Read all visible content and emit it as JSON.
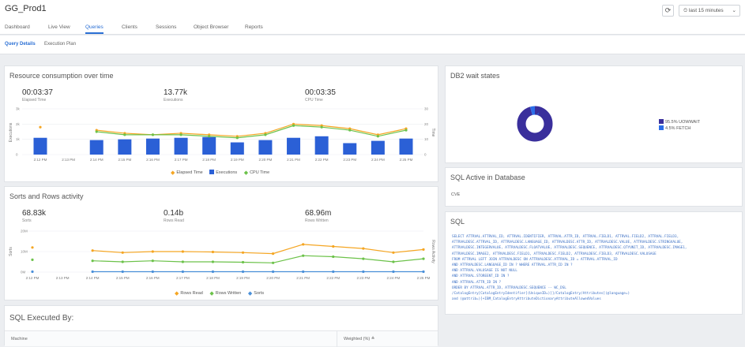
{
  "app": {
    "title": "GG_Prod1"
  },
  "nav": {
    "tabs": [
      "Dashboard",
      "Live View",
      "Queries",
      "Clients",
      "Sessions",
      "Object Browser",
      "Reports"
    ],
    "active": "Queries"
  },
  "toolbar": {
    "refresh_icon": "refresh-icon",
    "time_range": "last 15 minutes",
    "time_icon": "clock-icon"
  },
  "subtabs": {
    "items": [
      "Query Details",
      "Execution Plan"
    ],
    "active": "Query Details"
  },
  "resource": {
    "title": "Resource consumption over time",
    "metrics": [
      {
        "value": "00:03:37",
        "label": "Elapsed Time"
      },
      {
        "value": "13.77k",
        "label": "Executions"
      },
      {
        "value": "00:03:35",
        "label": "CPU Time"
      }
    ],
    "y_left_label": "Executions",
    "y_right_label": "Time",
    "y_left_ticks": [
      "3k",
      "2k",
      "1k",
      "0"
    ],
    "y_right_ticks": [
      "30",
      "20",
      "10",
      "0"
    ],
    "legend": [
      "Elapsed Time",
      "Executions",
      "CPU Time"
    ]
  },
  "sorts": {
    "title": "Sorts and Rows activity",
    "metrics": [
      {
        "value": "68.83k",
        "label": "Sorts"
      },
      {
        "value": "0.14b",
        "label": "Rows Read"
      },
      {
        "value": "68.96m",
        "label": "Rows Written"
      }
    ],
    "y_left_label": "Sorts",
    "y_right_label": "Rows Activity",
    "y_left_ticks": [
      "20M",
      "10M",
      "0M"
    ],
    "legend": [
      "Rows Read",
      "Rows Written",
      "Sorts"
    ]
  },
  "executed_by": {
    "title": "SQL Executed By:",
    "columns": [
      "Machine",
      "Weighted (%) ≜"
    ]
  },
  "db2wait": {
    "title": "DB2 wait states",
    "legend": [
      "95.5% UOWWAIT",
      "4.5% FETCH"
    ],
    "colors": [
      "#3a2f9c",
      "#2b6ee8"
    ]
  },
  "active": {
    "title": "SQL Active in Database",
    "value": "CVE"
  },
  "sql": {
    "title": "SQL",
    "lines": [
      "SELECT ATTRVAL.ATTRVAL_ID, ATTRVAL.IDENTIFIER, ATTRVAL.ATTR_ID, ATTRVAL.FIELD1, ATTRVAL.FIELD2, ATTRVAL.FIELD3,",
      "ATTRVALDESC.ATTRVAL_ID, ATTRVALDESC.LANGUAGE_ID, ATTRVALDESC.ATTR_ID, ATTRVALDESC.VALUE, ATTRVALDESC.STRINGVALUE,",
      "ATTRVALDESC.INTEGERVALUE, ATTRVALDESC.FLOATVALUE, ATTRVALDESC.SEQUENCE, ATTRVALDESC.QTYUNIT_ID, ATTRVALDESC.IMAGE1,",
      "ATTRVALDESC.IMAGE2, ATTRVALDESC.FIELD1, ATTRVALDESC.FIELD2, ATTRVALDESC.FIELD3, ATTRVALDESC.VALUSAGE",
      "FROM ATTRVAL LEFT JOIN ATTRVALDESC ON ATTRVALDESC.ATTRVAL_ID = ATTRVAL.ATTRVAL_ID",
      "AND ATTRVALDESC.LANGUAGE_ID IN ? WHERE ATTRVAL.ATTR_ID IN ?",
      "AND ATTRVAL.VALUSAGE IS NOT NULL",
      "AND ATTRVAL.STOREENT_ID IN ?",
      "AND ATTRVAL.ATTR_ID IN ?",
      "ORDER BY ATTRVAL.ATTR_ID, ATTRVALDESC.SEQUENCE -- WC_DSL",
      "/CatalogEntry[CatalogEntryIdentifier[(UniqueID=)]]/CatalogEntry/Attributes[(@language=)",
      "and (@attrib=)]+IBM_CatalogEntryAttributeDictionaryAttributeAllowedValues"
    ]
  },
  "chart_data": [
    {
      "type": "bar",
      "title": "Resource consumption over time",
      "categories": [
        "2:12 PM",
        "2:13 PM",
        "2:14 PM",
        "2:15 PM",
        "2:16 PM",
        "2:17 PM",
        "2:18 PM",
        "2:19 PM",
        "2:20 PM",
        "2:21 PM",
        "2:22 PM",
        "2:23 PM",
        "2:24 PM",
        "2:25 PM"
      ],
      "ylabel": "Executions",
      "y2label": "Time",
      "ylim": [
        0,
        3000
      ],
      "y2lim": [
        0,
        30
      ],
      "series": [
        {
          "name": "Executions",
          "kind": "bar",
          "axis": "left",
          "color": "#2b60d6",
          "values": [
            1100,
            null,
            950,
            1000,
            1050,
            1100,
            1150,
            800,
            950,
            1100,
            1200,
            750,
            900,
            1050
          ]
        },
        {
          "name": "Elapsed Time",
          "kind": "line",
          "axis": "right",
          "color": "#f5a623",
          "values": [
            18,
            null,
            16,
            14,
            13,
            14,
            13,
            12,
            14,
            20,
            19,
            17,
            13,
            17
          ]
        },
        {
          "name": "CPU Time",
          "kind": "line",
          "axis": "right",
          "color": "#6cc24a",
          "values": [
            null,
            null,
            15,
            13,
            13,
            13,
            12,
            11,
            13,
            19,
            18,
            16,
            12,
            16
          ]
        }
      ]
    },
    {
      "type": "line",
      "title": "Sorts and Rows activity",
      "categories": [
        "2:12 PM",
        "2:13 PM",
        "2:14 PM",
        "2:15 PM",
        "2:16 PM",
        "2:17 PM",
        "2:18 PM",
        "2:19 PM",
        "2:20 PM",
        "2:21 PM",
        "2:22 PM",
        "2:23 PM",
        "2:24 PM",
        "2:25 PM"
      ],
      "ylabel": "Sorts",
      "y2label": "Rows Activity",
      "ylim": [
        0,
        20
      ],
      "series": [
        {
          "name": "Rows Read",
          "color": "#f5a623",
          "values": [
            12,
            null,
            10.5,
            9.5,
            10,
            10,
            9.8,
            9.5,
            9,
            13.5,
            12.5,
            11.5,
            9.5,
            11
          ]
        },
        {
          "name": "Rows Written",
          "color": "#6cc24a",
          "values": [
            6,
            null,
            5.5,
            5,
            5.5,
            5,
            5,
            4.8,
            4.5,
            8,
            7.5,
            6.5,
            5,
            6.5
          ]
        },
        {
          "name": "Sorts",
          "color": "#4a90d9",
          "values": [
            0.2,
            null,
            0.2,
            0.2,
            0.2,
            0.2,
            0.2,
            0.2,
            0.2,
            0.2,
            0.2,
            0.2,
            0.2,
            0.2
          ]
        }
      ]
    },
    {
      "type": "pie",
      "title": "DB2 wait states",
      "labels": [
        "UOWWAIT",
        "FETCH"
      ],
      "values": [
        95.5,
        4.5
      ],
      "colors": [
        "#3a2f9c",
        "#2b6ee8"
      ]
    }
  ]
}
